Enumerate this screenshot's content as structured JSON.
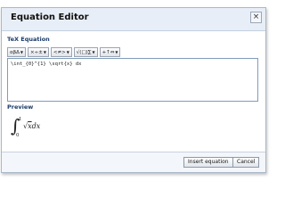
{
  "dialog": {
    "title": "Equation Editor",
    "close_glyph": "×"
  },
  "tex_section": {
    "label": "TeX Equation",
    "toolbar": [
      {
        "label": "αβΔ",
        "icon": "greek-letters-icon"
      },
      {
        "label": "×÷±",
        "icon": "operators-icon"
      },
      {
        "label": "<≠>",
        "icon": "relations-icon"
      },
      {
        "label": "√(□)∑",
        "icon": "functions-icon"
      },
      {
        "label": "+↑⇔",
        "icon": "arrows-icon"
      }
    ],
    "dropdown_glyph": "▼",
    "latex_value": "\\int_{0}^{1} \\sqrt{x} dx"
  },
  "preview": {
    "label": "Preview",
    "integral_sign": "∫",
    "upper_limit": "1",
    "lower_limit": "0",
    "radical": "√",
    "radicand": "x",
    "differential": "dx"
  },
  "footer": {
    "insert_label": "Insert equation",
    "cancel_label": "Cancel"
  }
}
